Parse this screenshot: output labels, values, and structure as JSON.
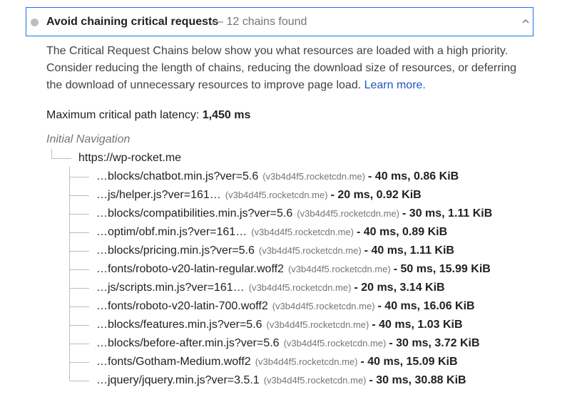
{
  "audit": {
    "title": "Avoid chaining critical requests",
    "display_value": "— 12 chains found",
    "status_color": "#bdbdbd",
    "accent_color": "#1a73e8"
  },
  "description": {
    "text": "The Critical Request Chains below show you what resources are loaded with a high priority. Consider reducing the length of chains, reducing the download size of resources, or deferring the download of unnecessary resources to improve page load.",
    "link_label": "Learn more."
  },
  "latency": {
    "label": "Maximum critical path latency:",
    "value": "1,450 ms"
  },
  "tree": {
    "initial_label": "Initial Navigation",
    "root_url": "https://wp-rocket.me",
    "chains": [
      {
        "url": "…blocks/chatbot.min.js?ver=5.6",
        "host": "(v3b4d4f5.rocketcdn.me)",
        "stats": "- 40 ms, 0.86 KiB"
      },
      {
        "url": "…js/helper.js?ver=161…",
        "host": "(v3b4d4f5.rocketcdn.me)",
        "stats": "- 20 ms, 0.92 KiB"
      },
      {
        "url": "…blocks/compatibilities.min.js?ver=5.6",
        "host": "(v3b4d4f5.rocketcdn.me)",
        "stats": "- 30 ms, 1.11 KiB"
      },
      {
        "url": "…optim/obf.min.js?ver=161…",
        "host": "(v3b4d4f5.rocketcdn.me)",
        "stats": "- 40 ms, 0.89 KiB"
      },
      {
        "url": "…blocks/pricing.min.js?ver=5.6",
        "host": "(v3b4d4f5.rocketcdn.me)",
        "stats": "- 40 ms, 1.11 KiB"
      },
      {
        "url": "…fonts/roboto-v20-latin-regular.woff2",
        "host": "(v3b4d4f5.rocketcdn.me)",
        "stats": "- 50 ms, 15.99 KiB"
      },
      {
        "url": "…js/scripts.min.js?ver=161…",
        "host": "(v3b4d4f5.rocketcdn.me)",
        "stats": "- 20 ms, 3.14 KiB"
      },
      {
        "url": "…fonts/roboto-v20-latin-700.woff2",
        "host": "(v3b4d4f5.rocketcdn.me)",
        "stats": "- 40 ms, 16.06 KiB"
      },
      {
        "url": "…blocks/features.min.js?ver=5.6",
        "host": "(v3b4d4f5.rocketcdn.me)",
        "stats": "- 40 ms, 1.03 KiB"
      },
      {
        "url": "…blocks/before-after.min.js?ver=5.6",
        "host": "(v3b4d4f5.rocketcdn.me)",
        "stats": "- 30 ms, 3.72 KiB"
      },
      {
        "url": "…fonts/Gotham-Medium.woff2",
        "host": "(v3b4d4f5.rocketcdn.me)",
        "stats": "- 40 ms, 15.09 KiB"
      },
      {
        "url": "…jquery/jquery.min.js?ver=3.5.1",
        "host": "(v3b4d4f5.rocketcdn.me)",
        "stats": "- 30 ms, 30.88 KiB"
      }
    ]
  }
}
